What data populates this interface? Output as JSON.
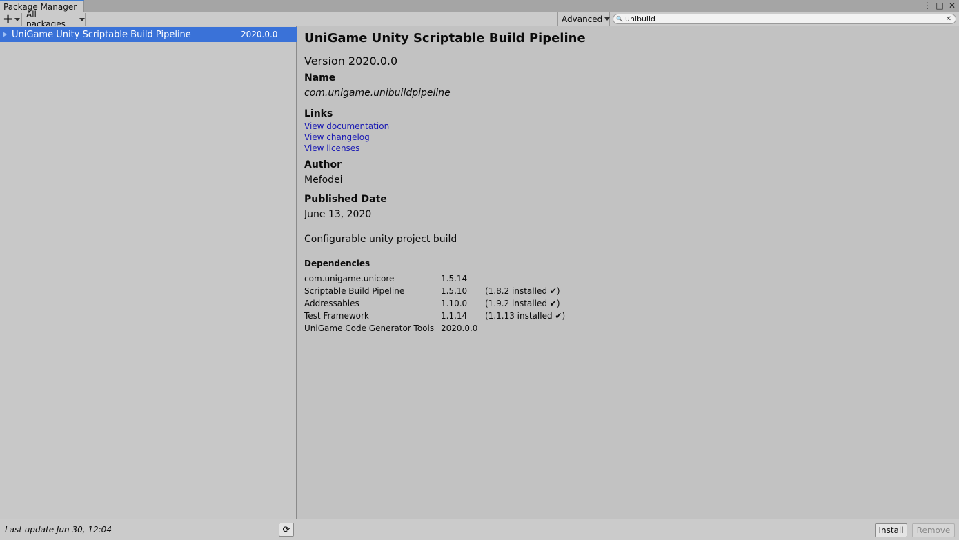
{
  "window": {
    "tab_title": "Package Manager",
    "controls": [
      "more-icon",
      "maximize-icon",
      "close-icon"
    ]
  },
  "toolbar": {
    "add_label": "+",
    "filter_label": "All packages",
    "advanced_label": "Advanced",
    "search_value": "unibuild",
    "search_placeholder": ""
  },
  "package_list": {
    "items": [
      {
        "name": "UniGame Unity Scriptable Build Pipeline",
        "version": "2020.0.0",
        "selected": true
      }
    ]
  },
  "details": {
    "title": "UniGame Unity Scriptable Build Pipeline",
    "version_line": "Version 2020.0.0",
    "name_label": "Name",
    "name_value": "com.unigame.unibuildpipeline",
    "links_label": "Links",
    "links": [
      "View documentation",
      "View changelog",
      "View licenses"
    ],
    "author_label": "Author",
    "author_value": "Mefodei",
    "date_label": "Published Date",
    "date_value": "June 13,  2020",
    "description": "Configurable unity project build",
    "dependencies_label": "Dependencies",
    "dependencies": [
      {
        "name": "com.unigame.unicore",
        "version": "1.5.14",
        "status": ""
      },
      {
        "name": "Scriptable Build Pipeline",
        "version": "1.5.10",
        "status": "(1.8.2 installed ✔)"
      },
      {
        "name": "Addressables",
        "version": "1.10.0",
        "status": "(1.9.2 installed ✔)"
      },
      {
        "name": "Test Framework",
        "version": "1.1.14",
        "status": "(1.1.13 installed ✔)"
      },
      {
        "name": "UniGame Code Generator Tools",
        "version": "2020.0.0",
        "status": ""
      }
    ]
  },
  "status": {
    "last_update": "Last update Jun 30, 12:04",
    "install_label": "Install",
    "remove_label": "Remove"
  },
  "colors": {
    "selection": "#3a72d8",
    "link": "#1a1ab3",
    "background": "#c2c2c2"
  }
}
